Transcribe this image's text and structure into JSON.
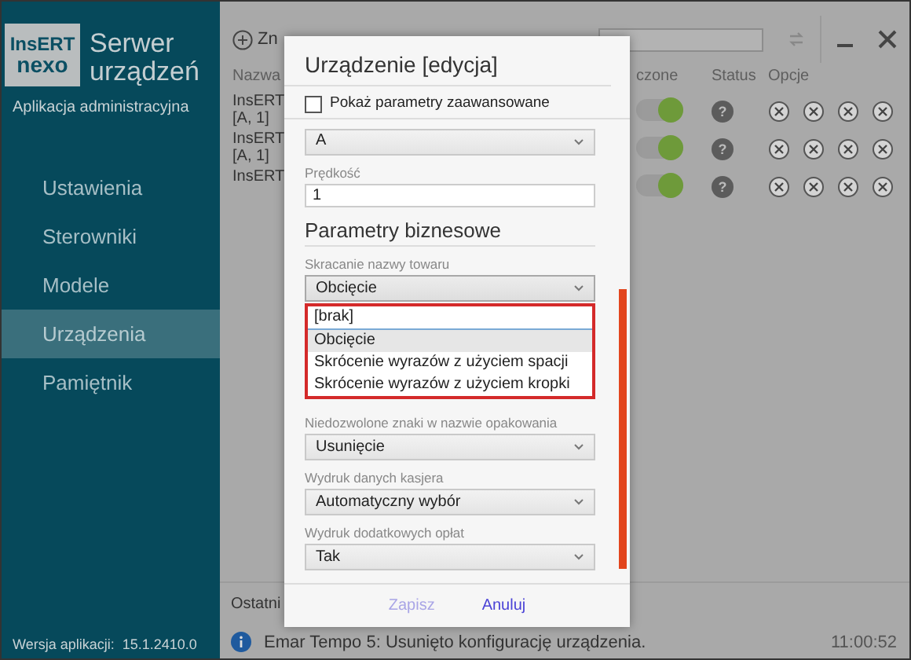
{
  "sidebar": {
    "logo_top": "InsERT",
    "logo_bottom": "nexo",
    "title": "Serwer urządzeń",
    "subtitle": "Aplikacja administracyjna",
    "nav": [
      {
        "label": "Ustawienia",
        "selected": false
      },
      {
        "label": "Sterowniki",
        "selected": false
      },
      {
        "label": "Modele",
        "selected": false
      },
      {
        "label": "Urządzenia",
        "selected": true
      },
      {
        "label": "Pamiętnik",
        "selected": false
      }
    ],
    "version_label": "Wersja aplikacji:",
    "version": "15.1.2410.0"
  },
  "main": {
    "add_label": "Zn",
    "columns": [
      "Nazwa",
      "czone",
      "Status",
      "Opcje"
    ],
    "rows": [
      {
        "name": "InsERT",
        "sub": "[A, 1]",
        "enabled": true,
        "status": "?"
      },
      {
        "name": "InsERT",
        "sub": "[A, 1]",
        "enabled": true,
        "status": "?"
      },
      {
        "name": "InsERT",
        "enabled": true,
        "status": "?"
      }
    ],
    "recent_label": "Ostatni",
    "message": "Emar Tempo 5: Usunięto konfigurację urządzenia.",
    "time": "11:00:52"
  },
  "dialog": {
    "title": "Urządzenie [edycja]",
    "advanced": {
      "label": "Pokaż parametry zaawansowane",
      "checked": false
    },
    "fields": [
      {
        "kind": "select",
        "value": "A"
      },
      {
        "kind": "input",
        "label": "Prędkość",
        "value": "1"
      }
    ],
    "section": "Parametry biznesowe",
    "business_fields": [
      {
        "label": "Skracanie nazwy towaru",
        "value": "Obcięcie",
        "expanded": true,
        "options": [
          {
            "label": "[brak]",
            "selected": false
          },
          {
            "label": "Obcięcie",
            "selected": true
          },
          {
            "label": "Skrócenie wyrazów z użyciem spacji",
            "selected": false
          },
          {
            "label": "Skrócenie wyrazów z użyciem kropki",
            "selected": false
          }
        ]
      },
      {
        "label": "Niedozwolone znaki w nazwie opakowania",
        "value": "Usunięcie",
        "expanded": false
      },
      {
        "label": "Wydruk danych kasjera",
        "value": "Automatyczny wybór",
        "expanded": false
      },
      {
        "label": "Wydruk dodatkowych opłat",
        "value": "Tak",
        "expanded": false
      }
    ],
    "buttons": [
      {
        "label": "Zapisz",
        "disabled": true
      },
      {
        "label": "Anuluj",
        "disabled": false
      }
    ]
  }
}
